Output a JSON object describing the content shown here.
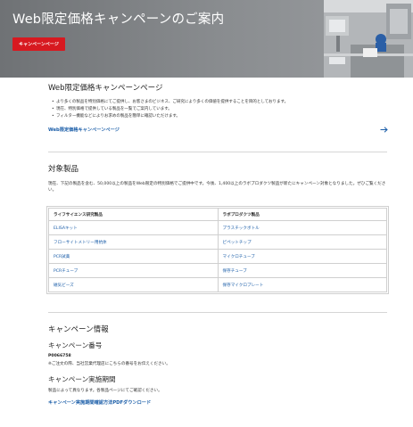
{
  "hero": {
    "title": "Web限定価格キャンペーンのご案内",
    "button_label": "キャンペーンページ"
  },
  "campaign_page": {
    "heading": "Web限定価格キャンペーンページ",
    "bullets": [
      "より多くの製品を特別価格にてご提供し、お客さまのビジネス、ご研究により多くの価値を提供することを目的としております。",
      "現在、特別価格で提供している製品を一覧でご案内しています。",
      "フィルター機能などによりお求めの製品を簡単に確認いただけます。"
    ],
    "link_label": "Web限定価格キャンペーンページ"
  },
  "products": {
    "heading": "対象製品",
    "description": "現在、下記の製品を含む、50,000以上の製品をWeb限定の特別価格でご提供中です。今後、1,400以上のラボプロダクツ製品が新たにキャンペーン対象となりました。ぜひご覧ください。",
    "columns": [
      "ライフサイエンス研究製品",
      "ラボプロダクツ製品"
    ],
    "rows": [
      [
        "ELISAキット",
        "プラスチックボトル"
      ],
      [
        "フローサイトメトリー用抗体",
        "ピペットチップ"
      ],
      [
        "PCR試薬",
        "マイクロチューブ"
      ],
      [
        "PCRチューブ",
        "保存チューブ"
      ],
      [
        "磁気ビーズ",
        "保存マイクロプレート"
      ]
    ]
  },
  "campaign_info": {
    "heading": "キャンペーン情報",
    "number_heading": "キャンペーン番号",
    "number_value": "P0066758",
    "number_note": "※ご注文の際、当社営業代理店にこちらの番号をお伝えください。",
    "period_heading": "キャンペーン実施期間",
    "period_note": "製品によって異なります。各製品ページにてご確認ください。",
    "download_link": "キャンペーン実施期間確認方法PDFダウンロード"
  },
  "colors": {
    "accent_red": "#d71920",
    "link_blue": "#1a5da8"
  }
}
